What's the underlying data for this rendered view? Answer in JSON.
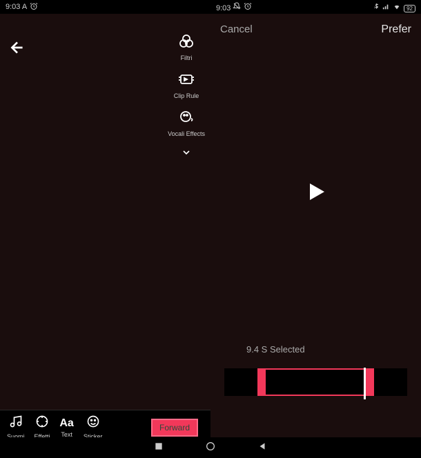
{
  "status": {
    "time_left": "9:03 A",
    "alarm_icon": "⏰",
    "time_right": "9:03",
    "dnd_icon": "🔕",
    "battery": "92"
  },
  "left_screen": {
    "tools": {
      "filters": {
        "label": "Filtri"
      },
      "clip": {
        "label": "Clip Rule"
      },
      "vocal": {
        "label": "Vocali Effects"
      }
    },
    "bottom": {
      "sounds": "Suomi",
      "effects": "Effetti",
      "text": "Text",
      "sticker": "Sticker",
      "forward": "Forward"
    }
  },
  "right_screen": {
    "cancel": "Cancel",
    "prefer": "Prefer",
    "selected_text": "9.4 S Selected"
  }
}
